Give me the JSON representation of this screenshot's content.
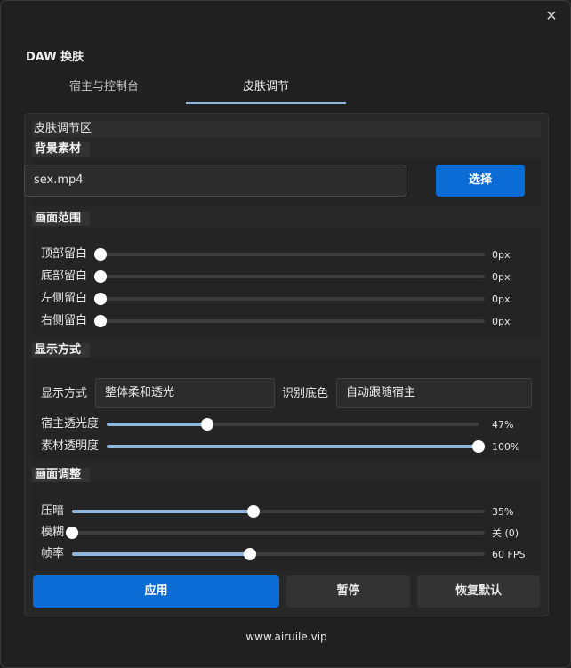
{
  "window": {
    "title": "DAW 换肤",
    "close_glyph": "✕"
  },
  "tabs": [
    {
      "label": "宿主与控制台",
      "active": false
    },
    {
      "label": "皮肤调节",
      "active": true
    }
  ],
  "region_title": "皮肤调节区",
  "background": {
    "header": "背景素材",
    "file_value": "sex.mp4",
    "select_button": "选择"
  },
  "range": {
    "header": "画面范围",
    "rows": [
      {
        "label": "顶部留白",
        "value_text": "0px",
        "fraction": 0
      },
      {
        "label": "底部留白",
        "value_text": "0px",
        "fraction": 0
      },
      {
        "label": "左侧留白",
        "value_text": "0px",
        "fraction": 0
      },
      {
        "label": "右侧留白",
        "value_text": "0px",
        "fraction": 0
      }
    ]
  },
  "display": {
    "header": "显示方式",
    "mode_label": "显示方式",
    "mode_value": "整体柔和透光",
    "color_label": "识别底色",
    "color_value": "自动跟随宿主",
    "rows": [
      {
        "label": "宿主透光度",
        "value_text": "47%",
        "fraction": 0.27
      },
      {
        "label": "素材透明度",
        "value_text": "100%",
        "fraction": 1.0
      }
    ]
  },
  "adjust": {
    "header": "画面调整",
    "rows": [
      {
        "label": "压暗",
        "value_text": "35%",
        "fraction": 0.44
      },
      {
        "label": "模糊",
        "value_text": "关 (0)",
        "fraction": 0
      },
      {
        "label": "帧率",
        "value_text": "60 FPS",
        "fraction": 0.43
      }
    ]
  },
  "actions": {
    "apply": "应用",
    "pause": "暂停",
    "reset": "恢复默认"
  },
  "footer": "www.airuile.vip",
  "colors": {
    "accent": "#0a6cd4",
    "slider_fill": "#8fb8de"
  }
}
